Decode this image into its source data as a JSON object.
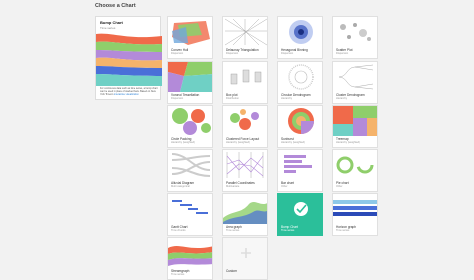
{
  "page": {
    "title": "Choose a Chart"
  },
  "selected": {
    "title": "Bump Chart",
    "category": "Time series",
    "description": "For continuous data such as time series, a bump chart can be used in place of stacked bars. Based on New York Times's",
    "link": "interactive visualization"
  },
  "charts": [
    {
      "id": "convex-hull",
      "name": "Convex Hull",
      "category": "Dispersion",
      "icon": "convex-hull-icon"
    },
    {
      "id": "delaunay",
      "name": "Delaunay Triangulation",
      "category": "Dispersion",
      "icon": "delaunay-icon"
    },
    {
      "id": "hexbin",
      "name": "Hexagonal Binning",
      "category": "Dispersion",
      "icon": "hexbin-icon"
    },
    {
      "id": "scatter",
      "name": "Scatter Plot",
      "category": "Dispersion",
      "icon": "scatter-icon"
    },
    {
      "id": "voronoi",
      "name": "Voronoi Tessellation",
      "category": "Dispersion",
      "icon": "voronoi-icon"
    },
    {
      "id": "boxplot",
      "name": "Box plot",
      "category": "Distribution",
      "icon": "boxplot-icon"
    },
    {
      "id": "circular-dendrogram",
      "name": "Circular Dendrogram",
      "category": "Hierarchy",
      "icon": "circular-dendrogram-icon"
    },
    {
      "id": "cluster-dendrogram",
      "name": "Cluster Dendrogram",
      "category": "Hierarchy",
      "icon": "cluster-dendrogram-icon"
    },
    {
      "id": "circle-packing",
      "name": "Circle Packing",
      "category": "Hierarchy (weighted)",
      "icon": "circle-packing-icon"
    },
    {
      "id": "clustered-force",
      "name": "Clustered Force Layout",
      "category": "Hierarchy (weighted)",
      "icon": "force-layout-icon"
    },
    {
      "id": "sunburst",
      "name": "Sunburst",
      "category": "Hierarchy (weighted)",
      "icon": "sunburst-icon"
    },
    {
      "id": "treemap",
      "name": "Treemap",
      "category": "Hierarchy (weighted)",
      "icon": "treemap-icon"
    },
    {
      "id": "alluvial",
      "name": "Alluvial Diagram",
      "category": "Multi categorical",
      "icon": "alluvial-icon"
    },
    {
      "id": "parallel",
      "name": "Parallel Coordinates",
      "category": "Multivariate",
      "icon": "parallel-coordinates-icon"
    },
    {
      "id": "bar",
      "name": "Bar chart",
      "category": "Other",
      "icon": "bar-chart-icon"
    },
    {
      "id": "pie",
      "name": "Pie chart",
      "category": "Other",
      "icon": "pie-chart-icon"
    },
    {
      "id": "gantt",
      "name": "Gantt Chart",
      "category": "Time chunks",
      "icon": "gantt-icon"
    },
    {
      "id": "area",
      "name": "Area graph",
      "category": "Time series",
      "icon": "area-graph-icon"
    },
    {
      "id": "bump",
      "name": "Bump Chart",
      "category": "Time series",
      "icon": "check-icon"
    },
    {
      "id": "horizon",
      "name": "Horizon graph",
      "category": "Time series",
      "icon": "horizon-graph-icon"
    },
    {
      "id": "streamgraph",
      "name": "Streamgraph",
      "category": "Time series",
      "icon": "streamgraph-icon"
    },
    {
      "id": "custom",
      "name": "Custom",
      "category": "",
      "icon": "plus-icon"
    }
  ],
  "colors": {
    "accent": "#2bbf9a",
    "green": "#8fce6b",
    "orange": "#f06a4a",
    "purple": "#b38ad9",
    "blue": "#4a6fd8"
  }
}
